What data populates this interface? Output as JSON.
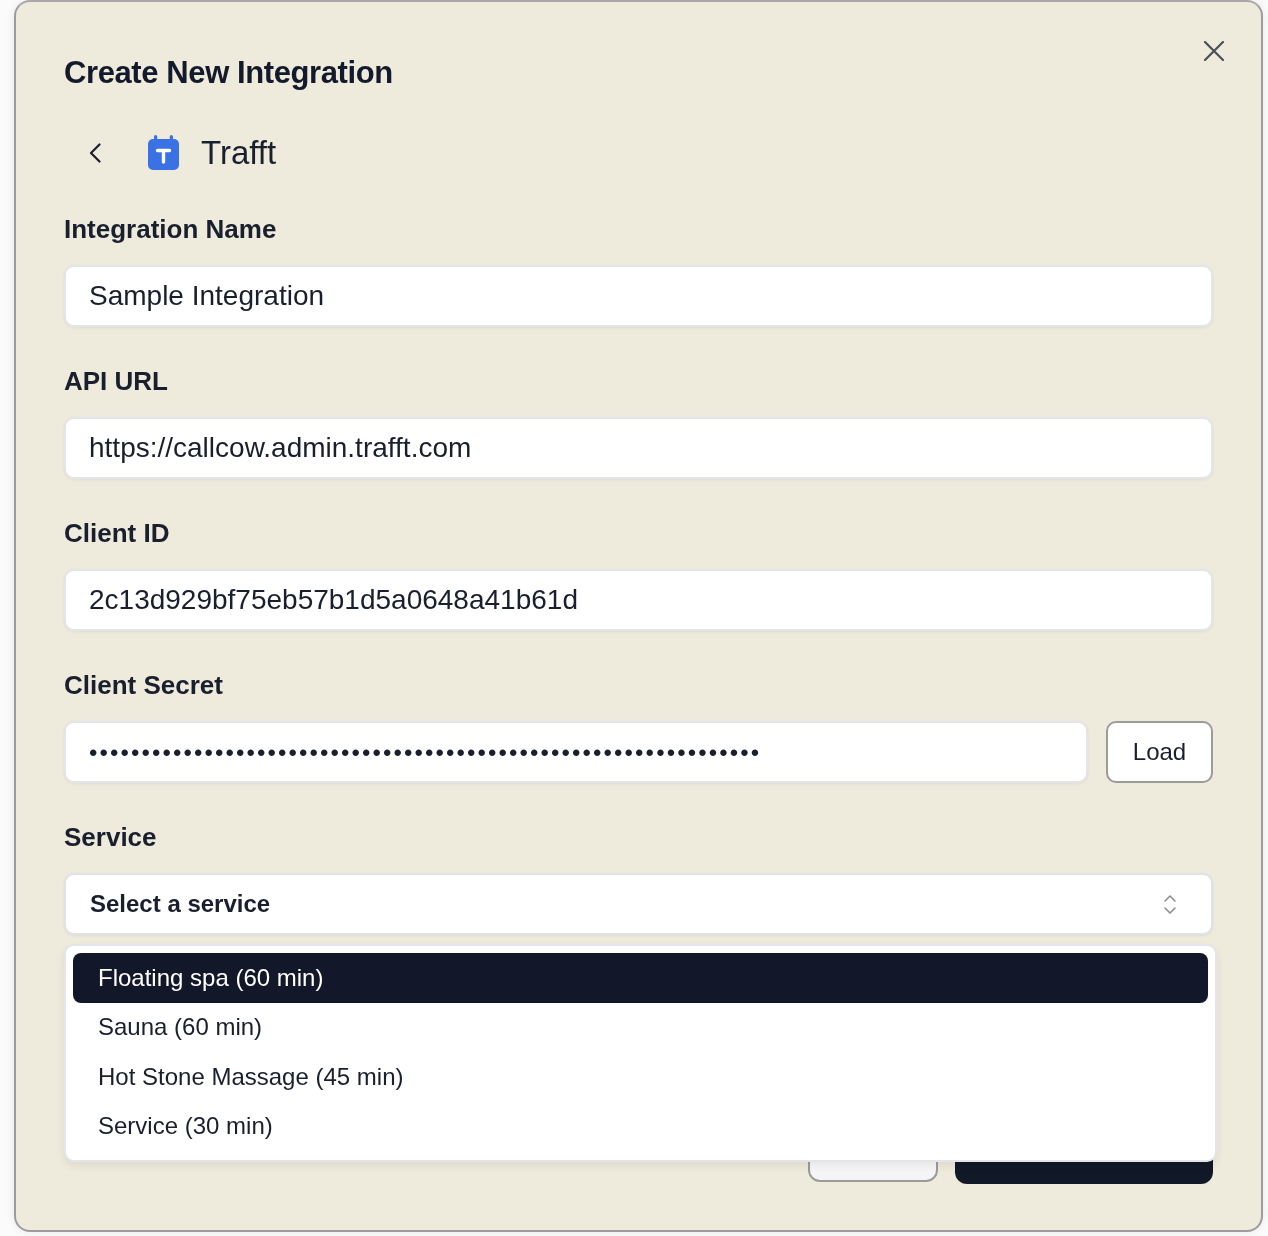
{
  "dialog": {
    "title": "Create New Integration"
  },
  "integration": {
    "name": "Trafft"
  },
  "fields": [
    {
      "kind": "text",
      "label": "Integration Name",
      "value": "Sample Integration"
    },
    {
      "kind": "text",
      "label": "API URL",
      "value": "https://callcow.admin.trafft.com"
    },
    {
      "kind": "text",
      "label": "Client ID",
      "value": "2c13d929bf75eb57b1d5a0648a41b61d"
    },
    {
      "kind": "password",
      "label": "Client Secret",
      "value": "••••••••••••••••••••••••••••••••••••••••••••••••••••••••••••••••",
      "button": "Load"
    },
    {
      "kind": "select",
      "label": "Service",
      "placeholder": "Select a service",
      "expanded": true,
      "options": [
        {
          "label": "Floating spa (60 min)",
          "selected": true
        },
        {
          "label": "Sauna (60 min)",
          "selected": false
        },
        {
          "label": "Hot Stone Massage (45 min)",
          "selected": false
        },
        {
          "label": "Service (30 min)",
          "selected": false
        }
      ]
    }
  ],
  "footer": {
    "buttons": [
      {
        "kind": "secondary"
      },
      {
        "kind": "primary"
      }
    ]
  }
}
